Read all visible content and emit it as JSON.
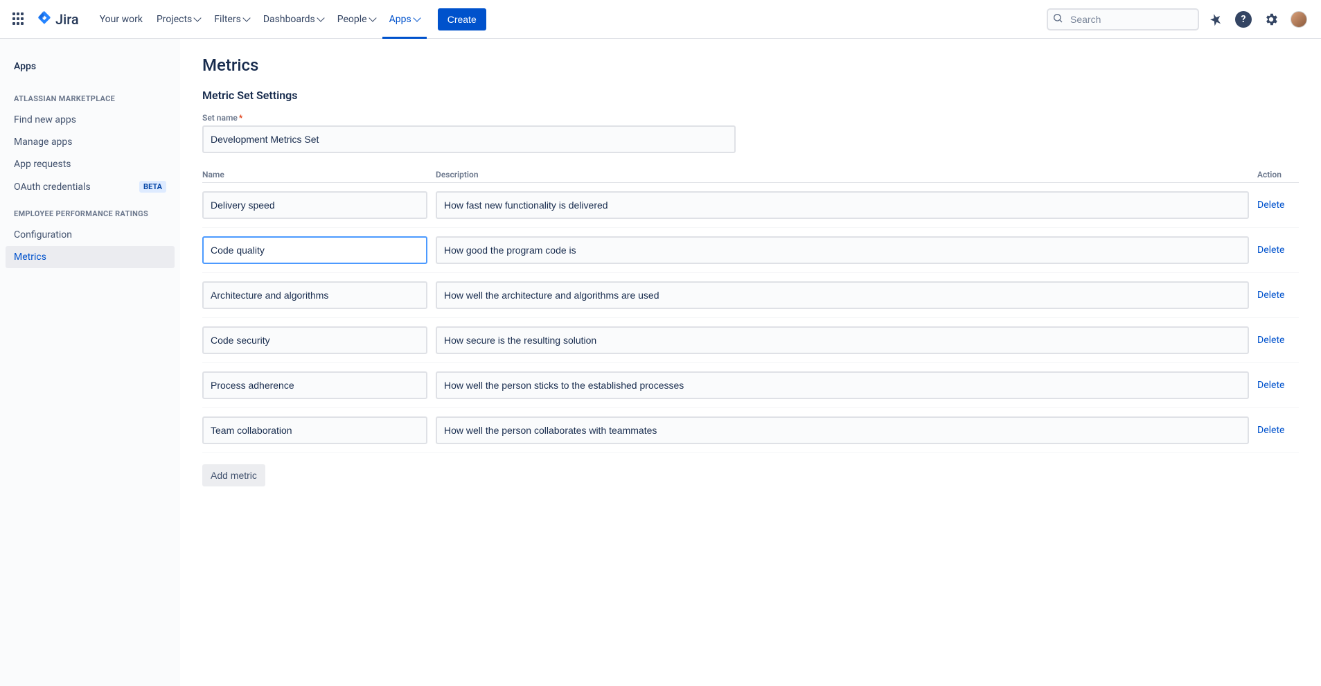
{
  "topnav": {
    "product": "Jira",
    "items": [
      "Your work",
      "Projects",
      "Filters",
      "Dashboards",
      "People",
      "Apps"
    ],
    "active_index": 5,
    "create_label": "Create",
    "search_placeholder": "Search"
  },
  "sidebar": {
    "title": "Apps",
    "sections": [
      {
        "heading": "ATLASSIAN MARKETPLACE",
        "items": [
          {
            "label": "Find new apps"
          },
          {
            "label": "Manage apps"
          },
          {
            "label": "App requests"
          },
          {
            "label": "OAuth credentials",
            "badge": "BETA"
          }
        ]
      },
      {
        "heading": "EMPLOYEE PERFORMANCE RATINGS",
        "items": [
          {
            "label": "Configuration"
          },
          {
            "label": "Metrics",
            "active": true
          }
        ]
      }
    ]
  },
  "content": {
    "page_title": "Metrics",
    "section_title": "Metric Set Settings",
    "set_name_label": "Set name",
    "set_name_value": "Development Metrics Set",
    "columns": {
      "name": "Name",
      "description": "Description",
      "action": "Action"
    },
    "delete_label": "Delete",
    "add_label": "Add metric",
    "metrics": [
      {
        "name": "Delivery speed",
        "description": "How fast new functionality is delivered"
      },
      {
        "name": "Code quality",
        "description": "How good the program code is",
        "focused": true
      },
      {
        "name": "Architecture and algorithms",
        "description": "How well the architecture and algorithms are used"
      },
      {
        "name": "Code security",
        "description": "How secure is the resulting solution"
      },
      {
        "name": "Process adherence",
        "description": "How well the person sticks to the established processes"
      },
      {
        "name": "Team collaboration",
        "description": "How well the person collaborates with teammates"
      }
    ]
  }
}
